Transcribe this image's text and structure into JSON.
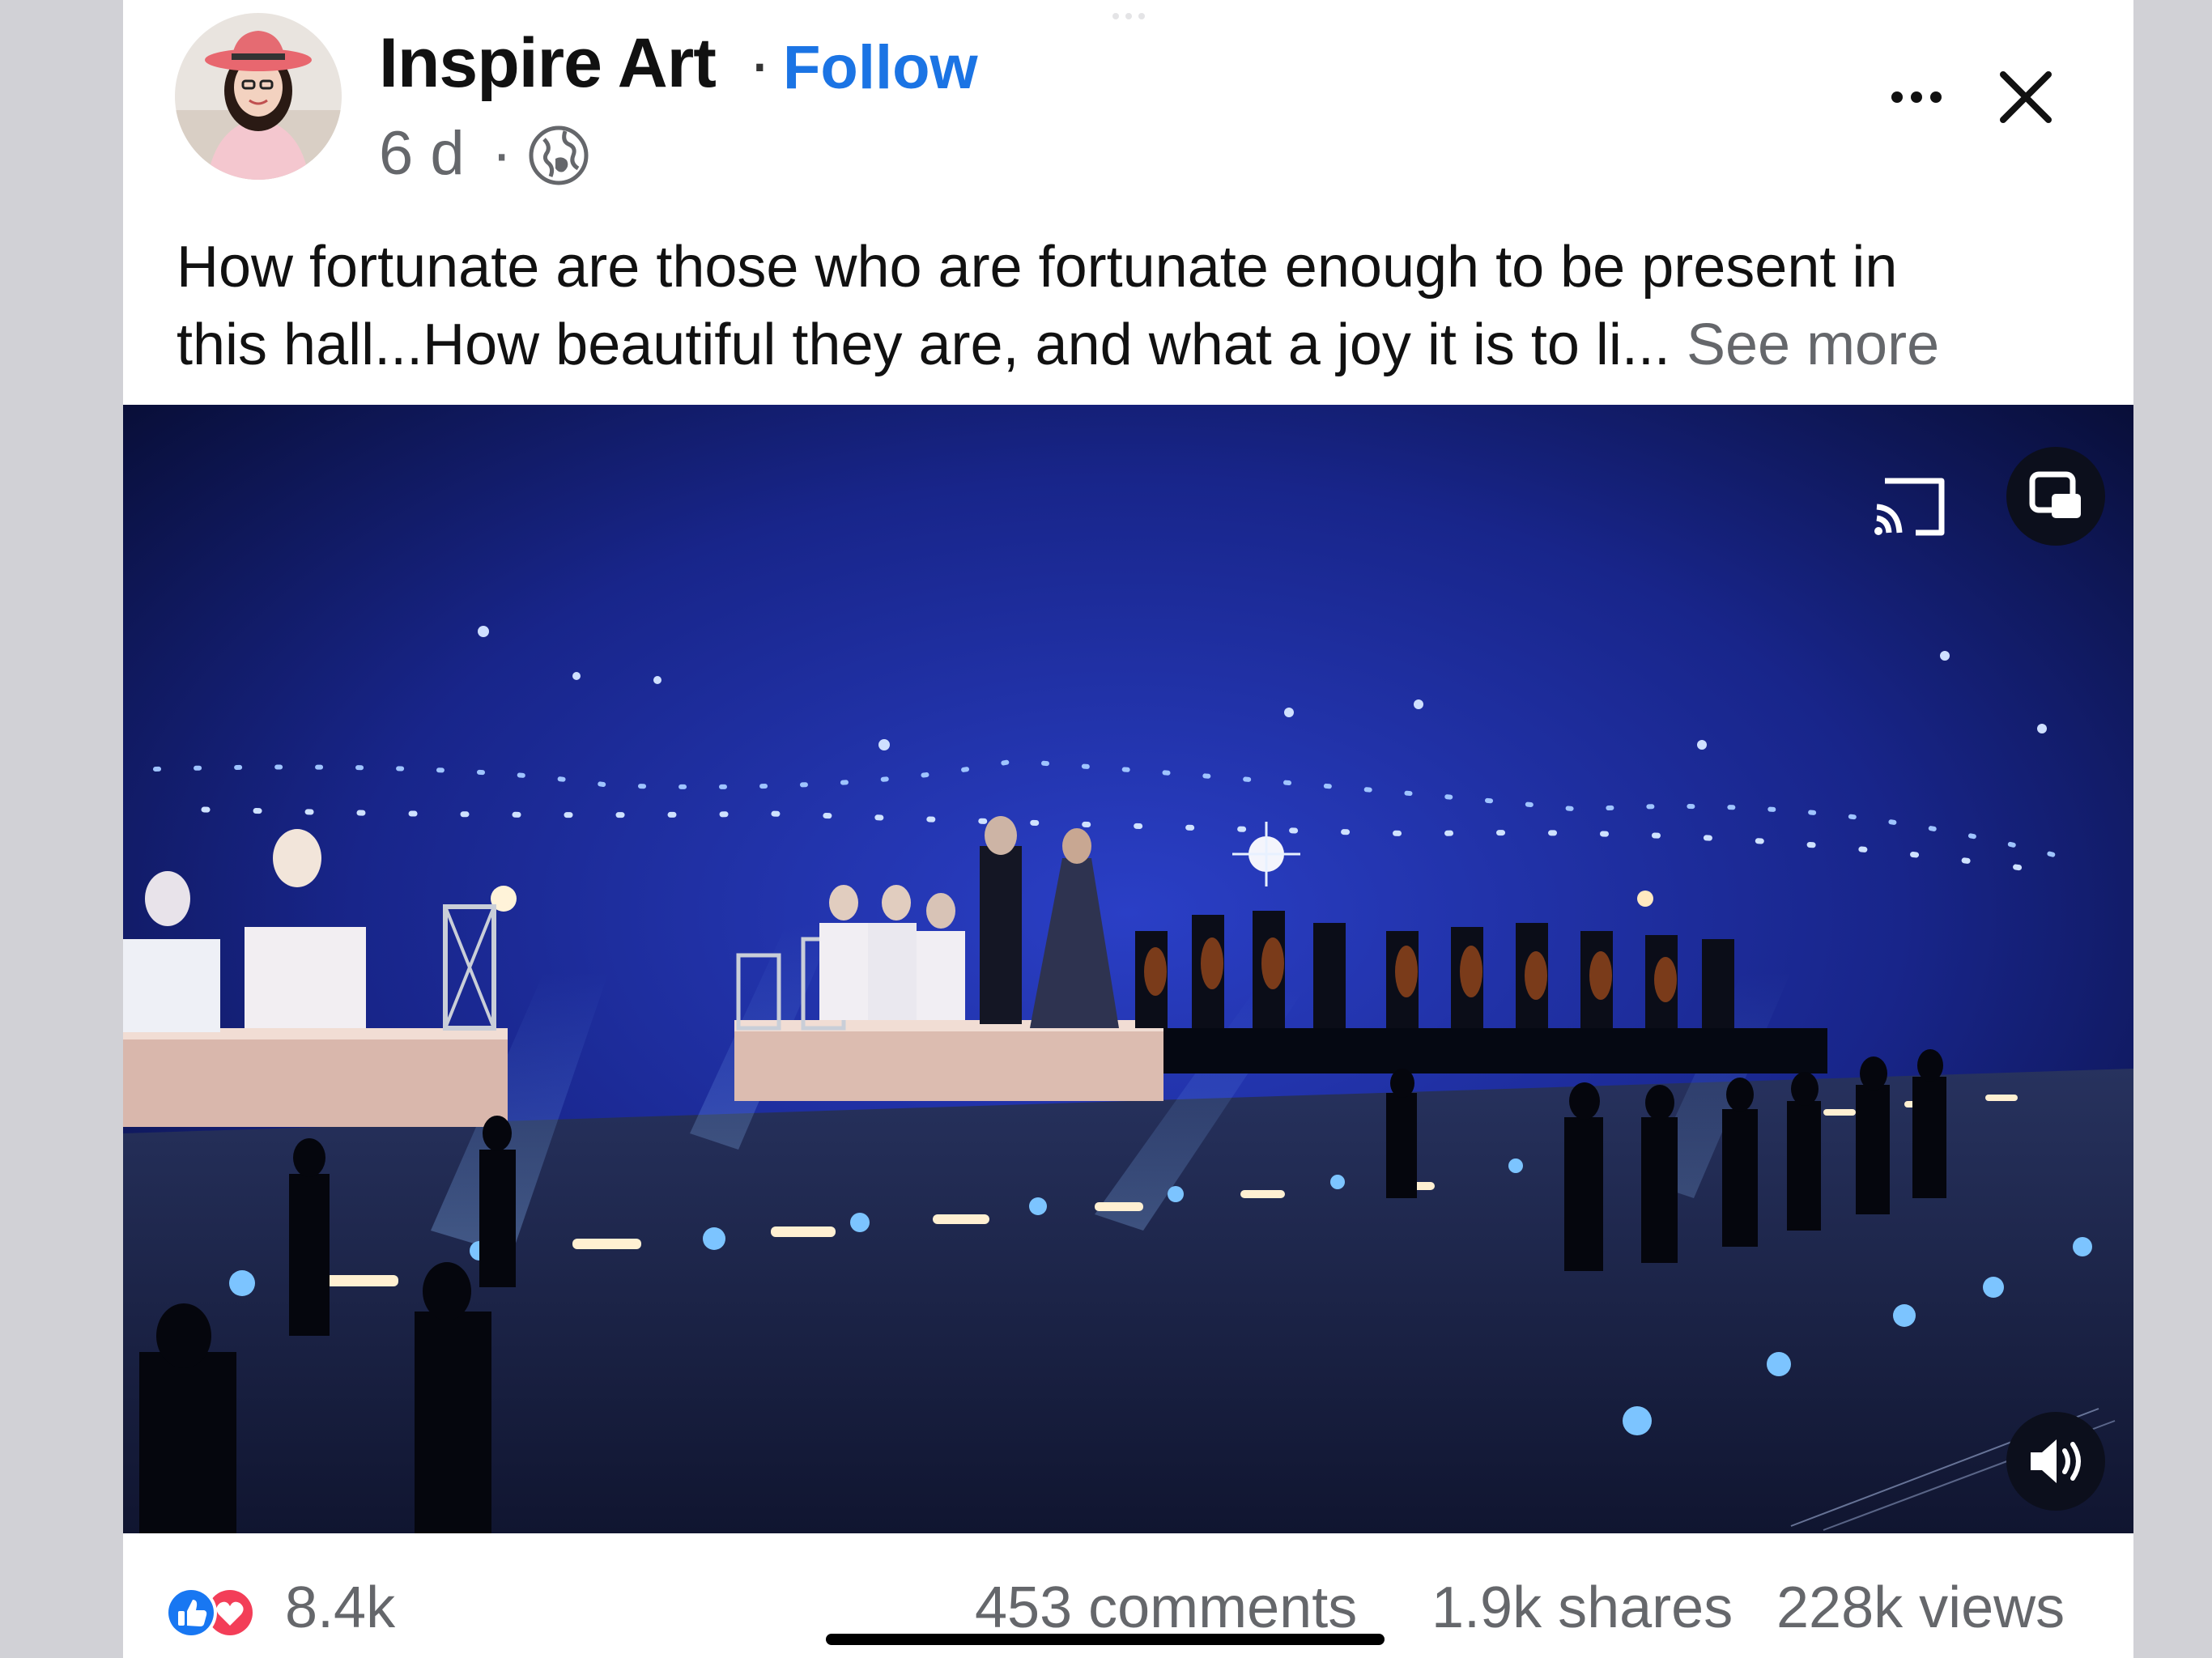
{
  "post": {
    "author": "Inspire Art",
    "separator": "·",
    "follow_label": "Follow",
    "age": "6 d",
    "audience_icon": "globe-icon",
    "caption_line1": "How fortunate are those who are fortunate enough to be present in",
    "caption_line2": "this hall...How beautiful they are, and what a joy it is to li...",
    "see_more_label": "See more"
  },
  "header_actions": {
    "more_icon": "more-horizontal-icon",
    "close_icon": "close-icon"
  },
  "video": {
    "controls": [
      "cast-icon",
      "picture-in-picture-icon",
      "volume-icon"
    ]
  },
  "stats": {
    "reactions_count": "8.4k",
    "reaction_icons": [
      "like-icon",
      "love-icon"
    ],
    "comments": "453 comments",
    "shares": "1.9k shares",
    "views": "228k views"
  },
  "colors": {
    "accent": "#1b74e4",
    "secondary_text": "#65676b",
    "like": "#1877f2",
    "love": "#f33e58"
  }
}
